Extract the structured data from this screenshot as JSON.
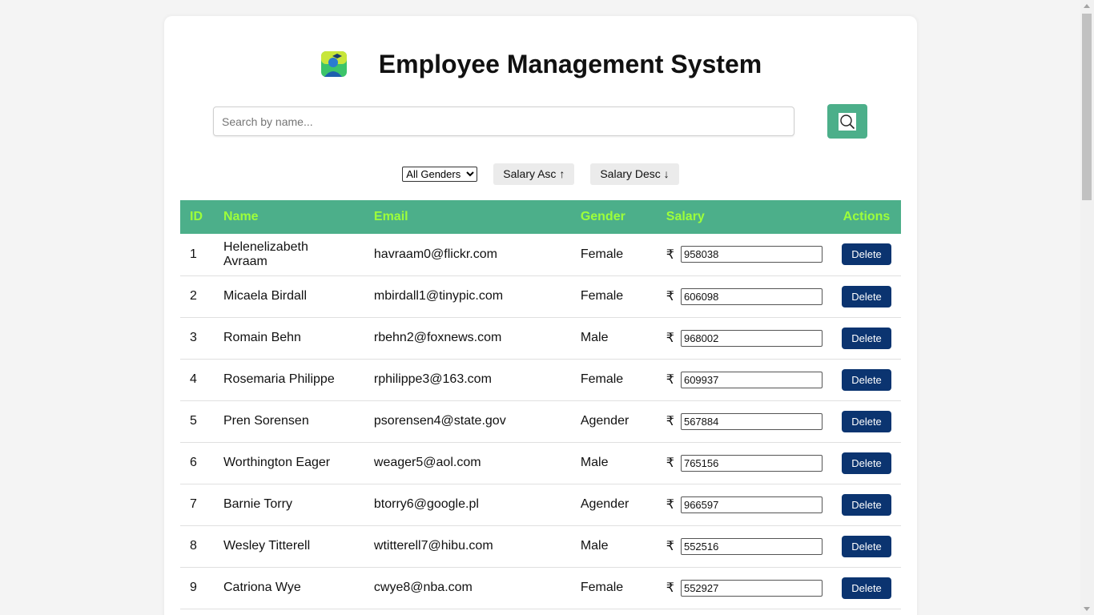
{
  "app": {
    "title": "Employee Management System"
  },
  "search": {
    "placeholder": "Search by name...",
    "icon": "search-icon"
  },
  "filters": {
    "gender_selected": "All Genders",
    "gender_options": [
      "All Genders"
    ],
    "sort_asc_label": "Salary Asc ↑",
    "sort_desc_label": "Salary Desc ↓"
  },
  "table": {
    "headers": {
      "id": "ID",
      "name": "Name",
      "email": "Email",
      "gender": "Gender",
      "salary": "Salary",
      "actions": "Actions"
    },
    "currency_symbol": "₹",
    "delete_label": "Delete",
    "rows": [
      {
        "id": "1",
        "name": "Helenelizabeth Avraam",
        "email": "havraam0@flickr.com",
        "gender": "Female",
        "salary": "958038"
      },
      {
        "id": "2",
        "name": "Micaela Birdall",
        "email": "mbirdall1@tinypic.com",
        "gender": "Female",
        "salary": "606098"
      },
      {
        "id": "3",
        "name": "Romain Behn",
        "email": "rbehn2@foxnews.com",
        "gender": "Male",
        "salary": "968002"
      },
      {
        "id": "4",
        "name": "Rosemaria Philippe",
        "email": "rphilippe3@163.com",
        "gender": "Female",
        "salary": "609937"
      },
      {
        "id": "5",
        "name": "Pren Sorensen",
        "email": "psorensen4@state.gov",
        "gender": "Agender",
        "salary": "567884"
      },
      {
        "id": "6",
        "name": "Worthington Eager",
        "email": "weager5@aol.com",
        "gender": "Male",
        "salary": "765156"
      },
      {
        "id": "7",
        "name": "Barnie Torry",
        "email": "btorry6@google.pl",
        "gender": "Agender",
        "salary": "966597"
      },
      {
        "id": "8",
        "name": "Wesley Titterell",
        "email": "wtitterell7@hibu.com",
        "gender": "Male",
        "salary": "552516"
      },
      {
        "id": "9",
        "name": "Catriona Wye",
        "email": "cwye8@nba.com",
        "gender": "Female",
        "salary": "552927"
      }
    ]
  },
  "colors": {
    "accent": "#4caf8a",
    "header_text": "#9dff3a",
    "delete_button": "#0b3470"
  }
}
